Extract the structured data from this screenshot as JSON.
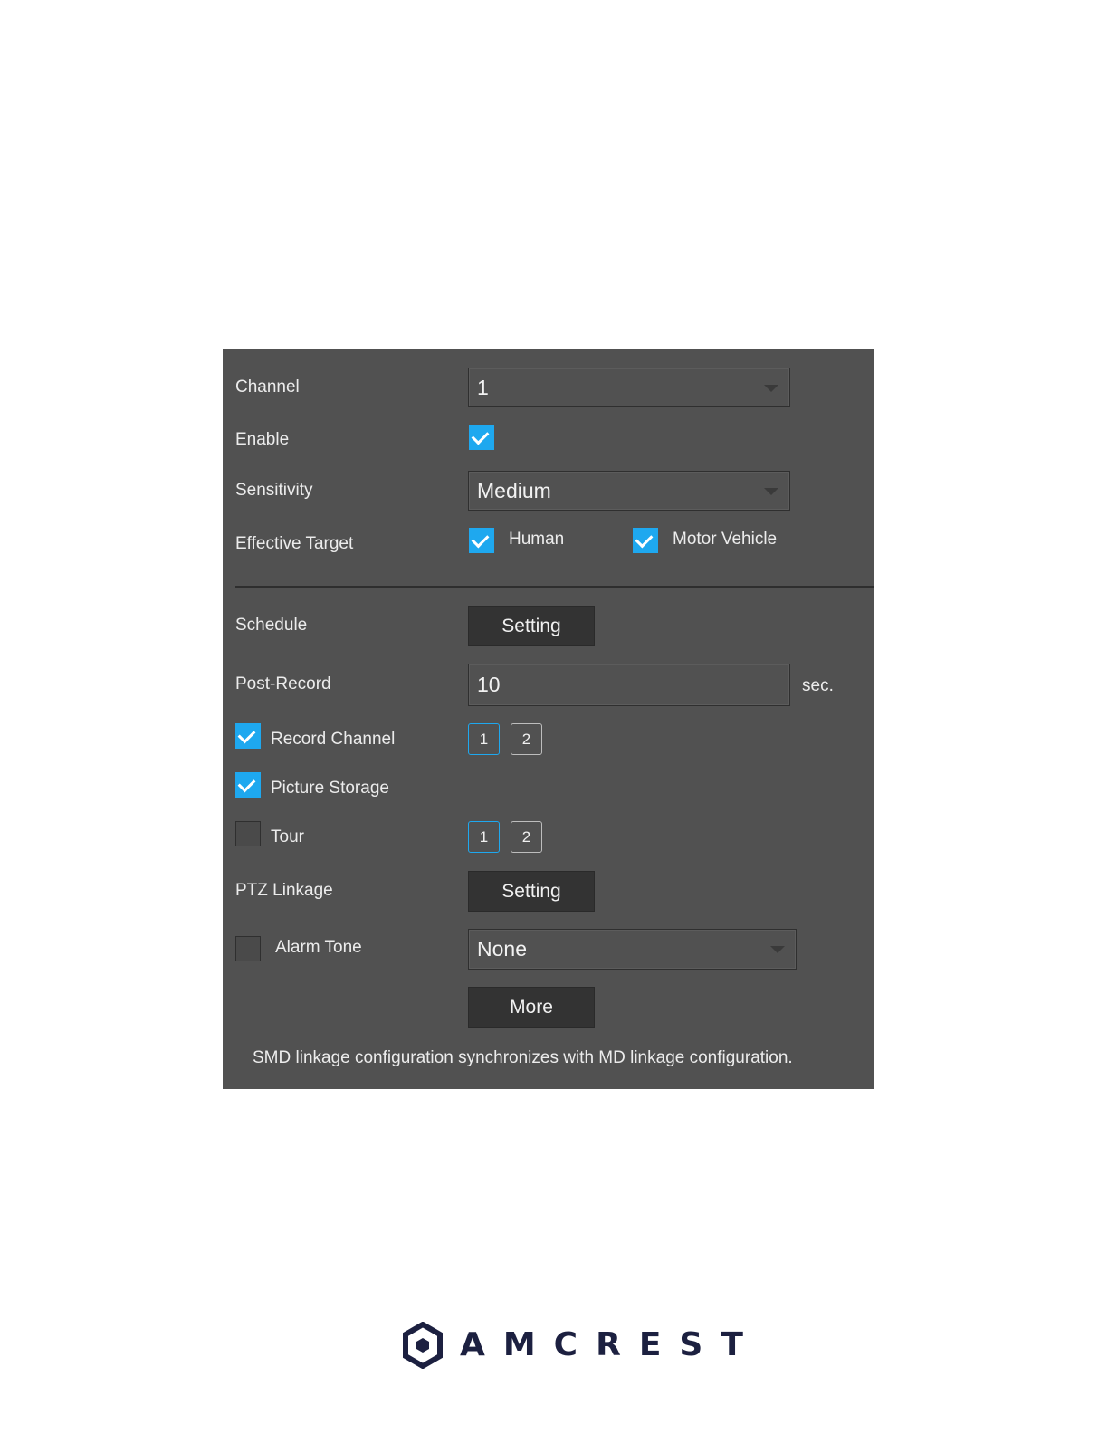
{
  "form": {
    "channel": {
      "label": "Channel",
      "value": "1"
    },
    "enable": {
      "label": "Enable",
      "checked": true
    },
    "sensitivity": {
      "label": "Sensitivity",
      "value": "Medium"
    },
    "effective_target": {
      "label": "Effective Target",
      "options": [
        {
          "label": "Human",
          "checked": true
        },
        {
          "label": "Motor Vehicle",
          "checked": true
        }
      ]
    },
    "schedule": {
      "label": "Schedule",
      "button": "Setting"
    },
    "post_record": {
      "label": "Post-Record",
      "value": "10",
      "unit": "sec."
    },
    "record_channel": {
      "label": "Record Channel",
      "checked": true,
      "channels": [
        "1",
        "2"
      ],
      "selected": "1"
    },
    "picture_storage": {
      "label": "Picture Storage",
      "checked": true
    },
    "tour": {
      "label": "Tour",
      "checked": false,
      "channels": [
        "1",
        "2"
      ],
      "selected": "1"
    },
    "ptz_linkage": {
      "label": "PTZ Linkage",
      "button": "Setting"
    },
    "alarm_tone": {
      "label": "Alarm Tone",
      "checked": false,
      "value": "None"
    },
    "more_button": "More",
    "note": "SMD linkage configuration synchronizes with MD linkage configuration."
  },
  "brand": {
    "logo_text": "AMCREST",
    "color": "#1c2040"
  },
  "colors": {
    "panel": "#515151",
    "accent": "#1ea8ef",
    "button": "#333333"
  },
  "icons": {
    "dropdown": "caret-down-icon",
    "check": "checkmark-icon",
    "logo": "amcrest-hexagon-icon"
  }
}
